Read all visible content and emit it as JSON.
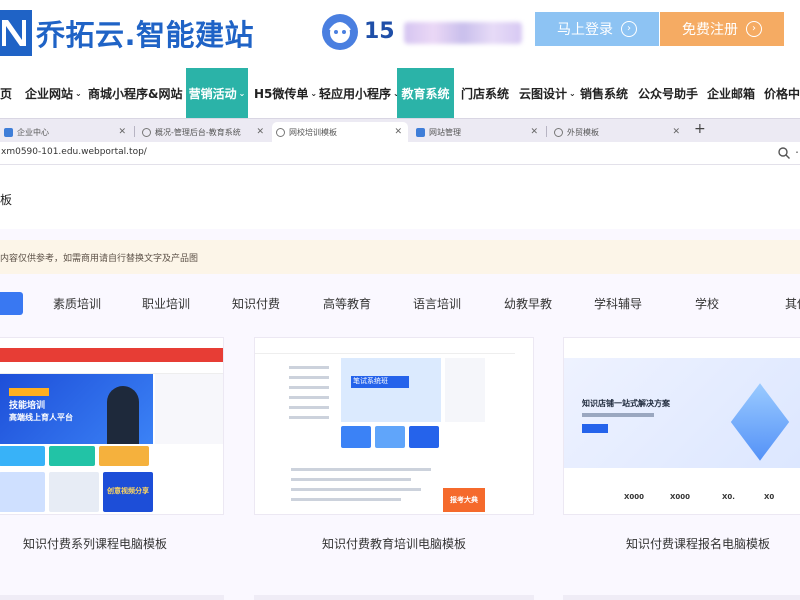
{
  "header": {
    "logo_text": "乔拓云.智能建站",
    "phone_visible": "15",
    "login_label": "马上登录",
    "register_label": "免费注册",
    "brand_color": "#1f63c6",
    "login_color": "#8dc3f3",
    "register_color": "#f5ab63"
  },
  "nav": {
    "active_color": "#2bb3a8",
    "items": [
      {
        "label": "页",
        "dropdown": false,
        "active": false
      },
      {
        "label": "企业网站",
        "dropdown": true,
        "active": false
      },
      {
        "label": "商城小程序&网站",
        "dropdown": true,
        "active": false
      },
      {
        "label": "营销活动",
        "dropdown": true,
        "active": true
      },
      {
        "label": "H5微传单",
        "dropdown": true,
        "active": false
      },
      {
        "label": "轻应用小程序",
        "dropdown": true,
        "active": false
      },
      {
        "label": "教育系统",
        "dropdown": false,
        "active": true
      },
      {
        "label": "门店系统",
        "dropdown": false,
        "active": false
      },
      {
        "label": "云图设计",
        "dropdown": true,
        "active": false
      },
      {
        "label": "销售系统",
        "dropdown": false,
        "active": false
      },
      {
        "label": "公众号助手",
        "dropdown": false,
        "active": false
      },
      {
        "label": "企业邮箱",
        "dropdown": false,
        "active": false
      },
      {
        "label": "价格中心",
        "dropdown": false,
        "active": false
      }
    ]
  },
  "browser": {
    "tabs": [
      {
        "label": "企业中心",
        "icon": "app-icon"
      },
      {
        "label": "概况-管理后台-教育系统",
        "icon": "globe-icon"
      },
      {
        "label": "网校培训模板",
        "icon": "globe-icon",
        "current": true
      },
      {
        "label": "网站管理",
        "icon": "app-icon"
      },
      {
        "label": "外贸模板",
        "icon": "globe-icon"
      }
    ],
    "url": "xm0590-101.edu.webportal.top/"
  },
  "page": {
    "crumb": "板",
    "notice": "内容仅供参考，如需商用请自行替换文字及产品图",
    "filters": [
      "素质培训",
      "职业培训",
      "知识付费",
      "高等教育",
      "语言培训",
      "幼教早教",
      "学科辅导",
      "学校",
      "其他"
    ],
    "accent_color": "#3978f2",
    "templates": [
      {
        "caption": "知识付费系列课程电脑模板",
        "thumb_banner": "技能培训",
        "thumb_banner_sub": "高端线上育人平台",
        "thumb_badge": "创意视频分享"
      },
      {
        "caption": "知识付费教育培训电脑模板",
        "thumb_banner": "笔试系统班",
        "thumb_badge": "报考大典"
      },
      {
        "caption": "知识付费课程报名电脑模板",
        "thumb_banner": "知识店铺一站式解决方案",
        "thumb_stats": [
          "X000",
          "X000",
          "X0.",
          "X0"
        ]
      }
    ]
  }
}
